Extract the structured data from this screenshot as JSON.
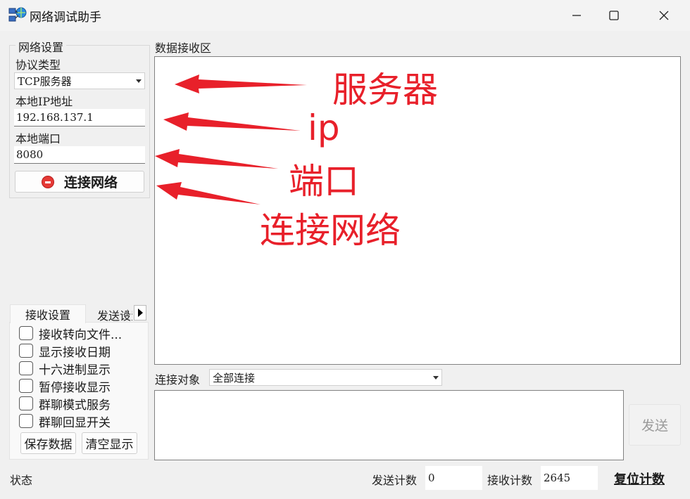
{
  "window": {
    "title": "网络调试助手",
    "icon": "network-globe-icon"
  },
  "network_settings": {
    "group_title": "网络设置",
    "protocol_label": "协议类型",
    "protocol_value": "TCP服务器",
    "local_ip_label": "本地IP地址",
    "local_ip_value": "192.168.137.1",
    "local_port_label": "本地端口",
    "local_port_value": "8080",
    "connect_button": "连接网络"
  },
  "tabs": {
    "active": "接收设置",
    "inactive": "发送设置"
  },
  "receive_options": [
    {
      "label": "接收转向文件...",
      "checked": false
    },
    {
      "label": "显示接收日期",
      "checked": false
    },
    {
      "label": "十六进制显示",
      "checked": false
    },
    {
      "label": "暂停接收显示",
      "checked": false
    },
    {
      "label": "群聊模式服务",
      "checked": false
    },
    {
      "label": "群聊回显开关",
      "checked": false
    }
  ],
  "receive_buttons": {
    "save": "保存数据",
    "clear": "清空显示"
  },
  "receive_area": {
    "label": "数据接收区",
    "content": ""
  },
  "connection_target": {
    "label": "连接对象",
    "value": "全部连接"
  },
  "send_area": {
    "content": "",
    "send_button": "发送"
  },
  "status_bar": {
    "status": "状态",
    "send_count_label": "发送计数",
    "send_count_value": "0",
    "recv_count_label": "接收计数",
    "recv_count_value": "2645",
    "reset_button": "复位计数"
  },
  "annotations": {
    "color": "#e8202a",
    "server": "服务器",
    "ip": "ip",
    "port": "端口",
    "connect": "连接网络"
  }
}
